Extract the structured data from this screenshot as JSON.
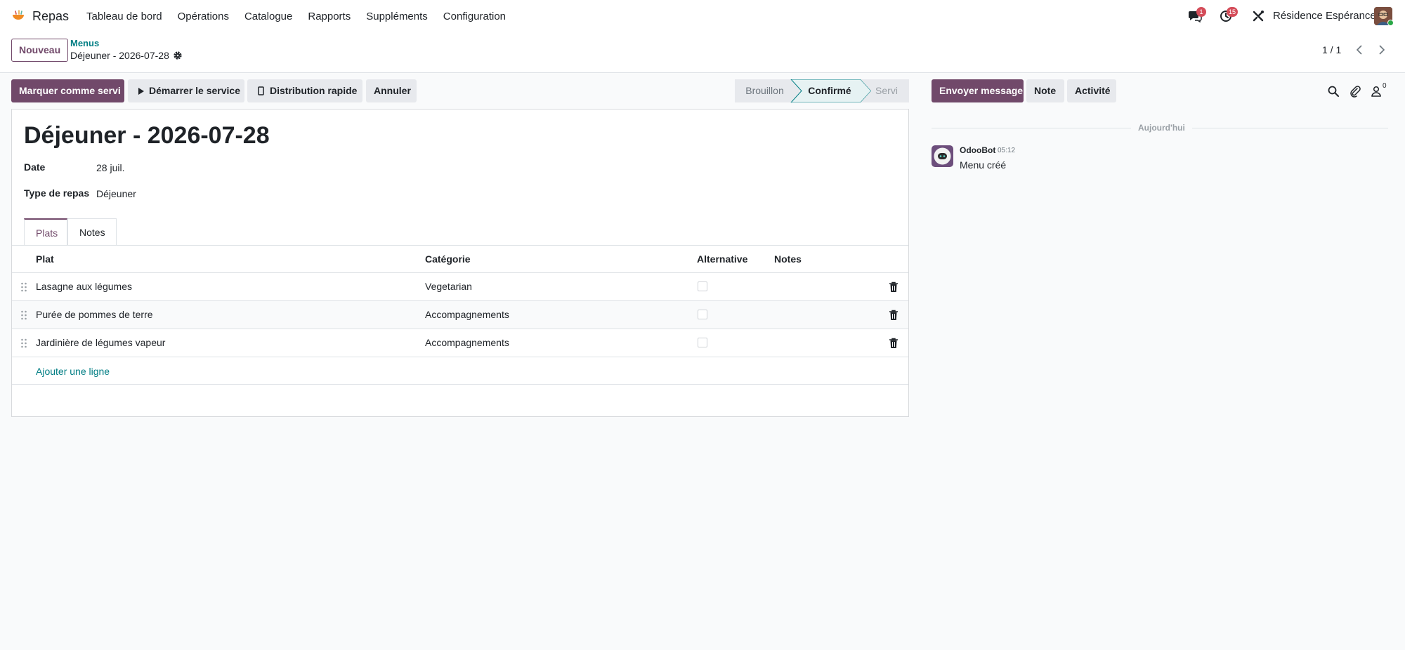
{
  "app": {
    "name": "Repas",
    "menu": [
      "Tableau de bord",
      "Opérations",
      "Catalogue",
      "Rapports",
      "Suppléments",
      "Configuration"
    ],
    "brand_color": "#71496a",
    "link_color": "#017e84"
  },
  "systray": {
    "messages_count": "1",
    "activities_count": "15",
    "company": "Résidence Espérance"
  },
  "control": {
    "new_label": "Nouveau",
    "breadcrumb_parent": "Menus",
    "breadcrumb_current": "Déjeuner - 2026-07-28",
    "pager": "1 / 1"
  },
  "actions": {
    "mark_served": "Marquer comme servi",
    "start_service": "Démarrer le service",
    "quick_distribution": "Distribution rapide",
    "cancel": "Annuler"
  },
  "stages": {
    "draft": "Brouillon",
    "confirmed": "Confirmé",
    "served": "Servi",
    "current": "confirmed"
  },
  "record": {
    "title": "Déjeuner - 2026-07-28",
    "date_label": "Date",
    "date_value": "28 juil.",
    "meal_type_label": "Type de repas",
    "meal_type_value": "Déjeuner"
  },
  "tabs": [
    "Plats",
    "Notes"
  ],
  "table": {
    "headers": [
      "Plat",
      "Catégorie",
      "Alternative",
      "Notes"
    ],
    "rows": [
      {
        "dish": "Lasagne aux légumes",
        "category": "Vegetarian",
        "alternative": false,
        "notes": ""
      },
      {
        "dish": "Purée de pommes de terre",
        "category": "Accompagnements",
        "alternative": false,
        "notes": ""
      },
      {
        "dish": "Jardinière de légumes vapeur",
        "category": "Accompagnements",
        "alternative": false,
        "notes": ""
      }
    ],
    "add_line": "Ajouter une ligne"
  },
  "chatter": {
    "send_message": "Envoyer message",
    "note": "Note",
    "activity": "Activité",
    "followers_count": "0",
    "day_separator": "Aujourd'hui",
    "messages": [
      {
        "author": "OdooBot",
        "time": "05:12",
        "body": "Menu créé"
      }
    ]
  }
}
